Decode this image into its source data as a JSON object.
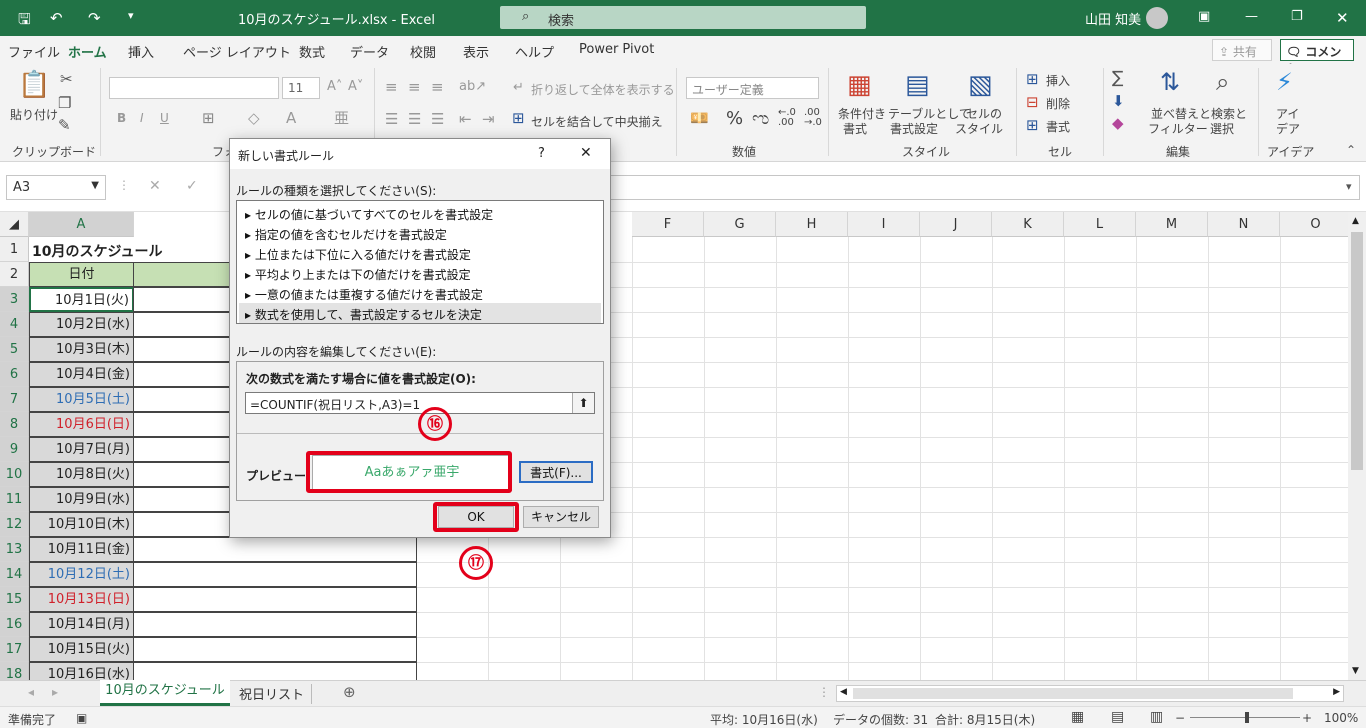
{
  "window": {
    "title": "10月のスケジュール.xlsx  -  Excel",
    "user": "山田 知美",
    "search_placeholder": "検索"
  },
  "tabs": [
    "ファイル",
    "ホーム",
    "挿入",
    "ページ レイアウト",
    "数式",
    "データ",
    "校閲",
    "表示",
    "ヘルプ",
    "Power Pivot"
  ],
  "share_label": "共有",
  "comment_label": "コメント",
  "ribbon": {
    "paste": "貼り付け",
    "clipboard": "クリップボード",
    "font_group_partial": "フォ",
    "font_size": "11",
    "wrap_text": "折り返して全体を表示する",
    "merge_center": "セルを結合して中央揃え",
    "number_format": "ユーザー定義",
    "number_group": "数値",
    "cond_format_1": "条件付き",
    "cond_format_2": "書式",
    "format_table_1": "テーブルとして",
    "format_table_2": "書式設定",
    "cell_styles_1": "セルの",
    "cell_styles_2": "スタイル",
    "styles_group": "スタイル",
    "insert": "挿入",
    "delete": "削除",
    "format": "書式",
    "cells_group": "セル",
    "sort_1": "並べ替えと",
    "sort_2": "フィルター",
    "find_1": "検索と",
    "find_2": "選択",
    "editing_group": "編集",
    "ideas_1": "アイ",
    "ideas_2": "デア",
    "ideas_group": "アイデア"
  },
  "name_box": "A3",
  "columns": [
    "A",
    "F",
    "G",
    "H",
    "I",
    "J",
    "K",
    "L",
    "M",
    "N",
    "O"
  ],
  "rows": [
    "1",
    "2",
    "3",
    "4",
    "5",
    "6",
    "7",
    "8",
    "9",
    "10",
    "11",
    "12",
    "13",
    "14",
    "15",
    "16",
    "17",
    "18"
  ],
  "sheet": {
    "title": "10月のスケジュール",
    "header": "日付",
    "dates": [
      {
        "t": "10月1日(火)",
        "c": "#000000"
      },
      {
        "t": "10月2日(水)",
        "c": "#000000"
      },
      {
        "t": "10月3日(木)",
        "c": "#000000"
      },
      {
        "t": "10月4日(金)",
        "c": "#000000"
      },
      {
        "t": "10月5日(土)",
        "c": "#2e6db4"
      },
      {
        "t": "10月6日(日)",
        "c": "#d0202a"
      },
      {
        "t": "10月7日(月)",
        "c": "#000000"
      },
      {
        "t": "10月8日(火)",
        "c": "#000000"
      },
      {
        "t": "10月9日(水)",
        "c": "#000000"
      },
      {
        "t": "10月10日(木)",
        "c": "#000000"
      },
      {
        "t": "10月11日(金)",
        "c": "#000000"
      },
      {
        "t": "10月12日(土)",
        "c": "#2e6db4"
      },
      {
        "t": "10月13日(日)",
        "c": "#d0202a"
      },
      {
        "t": "10月14日(月)",
        "c": "#000000"
      },
      {
        "t": "10月15日(火)",
        "c": "#000000"
      },
      {
        "t": "10月16日(水)",
        "c": "#000000"
      }
    ]
  },
  "dialog": {
    "title": "新しい書式ルール",
    "help": "?",
    "rule_type_label": "ルールの種類を選択してください(S):",
    "rules": [
      "セルの値に基づいてすべてのセルを書式設定",
      "指定の値を含むセルだけを書式設定",
      "上位または下位に入る値だけを書式設定",
      "平均より上または下の値だけを書式設定",
      "一意の値または重複する値だけを書式設定",
      "数式を使用して、書式設定するセルを決定"
    ],
    "edit_label": "ルールの内容を編集してください(E):",
    "formula_label": "次の数式を満たす場合に値を書式設定(O):",
    "formula": "=COUNTIF(祝日リスト,A3)=1",
    "preview_label": "プレビュー:",
    "preview_text": "Aaあぁアァ亜宇",
    "format_button": "書式(F)...",
    "ok": "OK",
    "cancel": "キャンセル"
  },
  "annotations": {
    "step16": "⑯",
    "step17": "⑰",
    "highlight_color": "#e3001a"
  },
  "sheet_tabs": [
    "10月のスケジュール",
    "祝日リスト"
  ],
  "status": {
    "ready": "準備完了",
    "average": "平均: 10月16日(水)",
    "count": "データの個数: 31",
    "sum": "合計: 8月15日(木)",
    "zoom": "100%"
  },
  "colors": {
    "excel_green": "#217346",
    "preview_text": "#3aa86b"
  }
}
